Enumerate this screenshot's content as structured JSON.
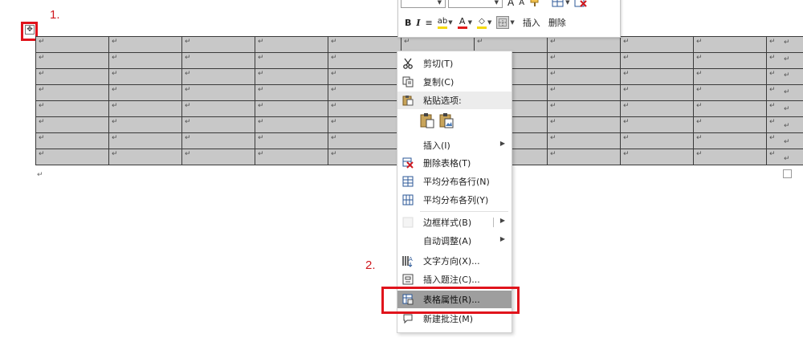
{
  "annotations": {
    "step1": "1.",
    "step2": "2."
  },
  "table": {
    "rows": 8,
    "cols": 11,
    "cell_mark": "↵",
    "after_mark": "↵"
  },
  "toolbar": {
    "a_large": "A",
    "a_small": "A",
    "bold": "B",
    "italic": "I",
    "align": "≡",
    "insert_label": "插入",
    "delete_label": "删除",
    "font_color": "#e01b1b",
    "highlight_color": "#f5d90a"
  },
  "menu": {
    "cut": "剪切(T)",
    "copy": "复制(C)",
    "paste_options": "粘贴选项:",
    "insert": "插入(I)",
    "delete_table": "删除表格(T)",
    "distribute_rows": "平均分布各行(N)",
    "distribute_cols": "平均分布各列(Y)",
    "border_style": "边框样式(B)",
    "autofit": "自动调整(A)",
    "text_direction": "文字方向(X)...",
    "insert_caption": "插入题注(C)...",
    "table_properties": "表格属性(R)...",
    "new_comment": "新建批注(M)"
  },
  "colors": {
    "annotation_red": "#e0141c",
    "cell_fill": "#c8c8c8",
    "highlight": "#9e9e9e"
  }
}
